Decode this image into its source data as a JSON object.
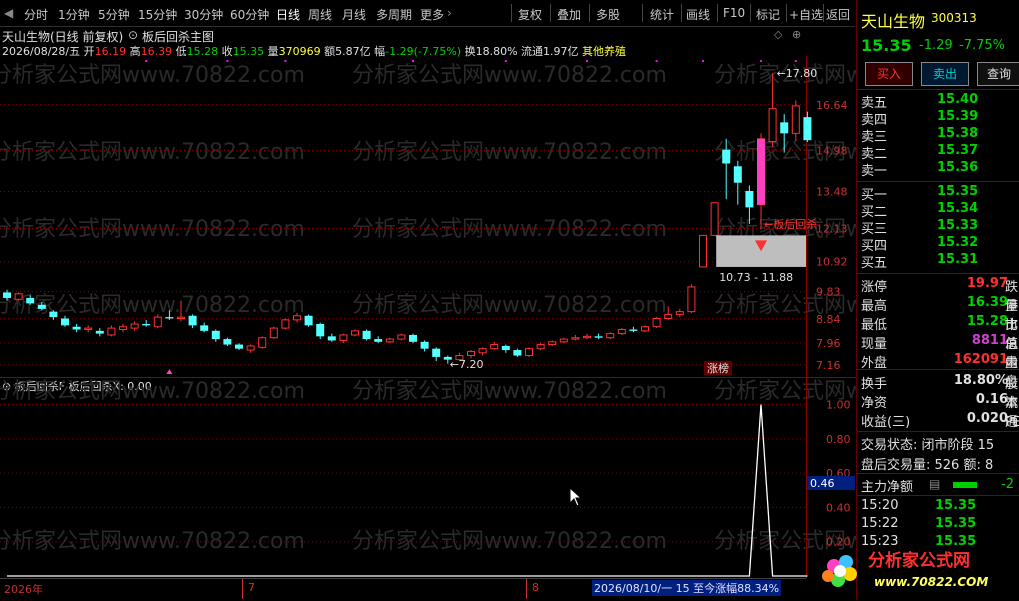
{
  "toolbar": {
    "items": [
      "分时",
      "1分钟",
      "5分钟",
      "15分钟",
      "30分钟",
      "60分钟",
      "日线",
      "周线",
      "月线",
      "多周期",
      "更多"
    ],
    "right_items": [
      "复权",
      "叠加",
      "多股",
      "统计",
      "画线",
      "F10",
      "标记",
      "+自选",
      "返回"
    ]
  },
  "header": {
    "title": "天山生物(日线 前复权)",
    "formula": "板后回杀主图",
    "date": "2026/08/28/五",
    "open_label": "开",
    "open": "16.19",
    "high_label": "高",
    "high": "16.39",
    "low_label": "低",
    "low": "15.28",
    "close_label": "收",
    "close": "15.35",
    "vol_label": "量",
    "vol": "370969",
    "amount_label": "额",
    "amount": "5.87亿",
    "change_label": "幅",
    "change": "-1.29(-7.75%)",
    "turnover_label": "换",
    "turnover": "18.80%",
    "float_label": "流通",
    "float": "1.97亿",
    "industry": "其他养殖"
  },
  "main_axis": [
    "16.64",
    "14.98",
    "13.48",
    "12.13",
    "10.92",
    "9.83",
    "8.84",
    "7.96",
    "7.16"
  ],
  "annotations": {
    "high_mark": "17.80",
    "low_mark": "7.20",
    "range_box": "10.73 - 11.88",
    "signal_text": "板后回杀",
    "zhangbang": "涨榜"
  },
  "indicator": {
    "title": "板后回杀F",
    "value_text": "板后回杀X: 0.00",
    "axis": [
      "1.00",
      "0.80",
      "0.60",
      "0.40",
      "0.20"
    ],
    "cursor_value": "0.46"
  },
  "bottom": {
    "year": "2026年",
    "month7": "7",
    "month8": "8",
    "range_text": "2026/08/10/一 15 至今涨幅88.34%"
  },
  "watermark": "分析家公式网www.70822.com",
  "panel": {
    "name": "天山生物",
    "code": "300313",
    "price": "15.35",
    "change": "-1.29",
    "change_pct": "-7.75%",
    "buy_btn": "买入",
    "sell_btn": "卖出",
    "query_btn": "查询",
    "asks": [
      {
        "label": "卖五",
        "price": "15.40"
      },
      {
        "label": "卖四",
        "price": "15.39"
      },
      {
        "label": "卖三",
        "price": "15.38"
      },
      {
        "label": "卖二",
        "price": "15.37"
      },
      {
        "label": "卖一",
        "price": "15.36"
      }
    ],
    "bids": [
      {
        "label": "买一",
        "price": "15.35"
      },
      {
        "label": "买二",
        "price": "15.34"
      },
      {
        "label": "买三",
        "price": "15.33"
      },
      {
        "label": "买四",
        "price": "15.32"
      },
      {
        "label": "买五",
        "price": "15.31"
      }
    ],
    "stats": [
      {
        "label": "涨停",
        "value": "19.97",
        "cut": "跌停",
        "color": "#ff3030"
      },
      {
        "label": "最高",
        "value": "16.39",
        "cut": "量比",
        "color": "#00d000"
      },
      {
        "label": "最低",
        "value": "15.28",
        "cut": "市值",
        "color": "#00d000"
      },
      {
        "label": "现量",
        "value": "8811",
        "cut": "总量",
        "color": "#d040d0"
      },
      {
        "label": "外盘",
        "value": "162091",
        "cut": "内盘",
        "color": "#ff3030"
      }
    ],
    "stats2": [
      {
        "label": "换手",
        "value": "18.80%",
        "cut": "股本",
        "color": "#e0e0e0"
      },
      {
        "label": "净资",
        "value": "0.16",
        "cut": "流通",
        "color": "#e0e0e0"
      },
      {
        "label": "收益(三)",
        "value": "0.020",
        "cut": "PE(动",
        "color": "#e0e0e0"
      }
    ],
    "trade_state": "交易状态: 闭市阶段 15",
    "after_vol": "盘后交易量: 526  额: 8",
    "main_net_label": "主力净额",
    "main_net_value": "-2",
    "ticks": [
      {
        "time": "15:20",
        "price": "15.35"
      },
      {
        "time": "15:22",
        "price": "15.35"
      },
      {
        "time": "15:23",
        "price": "15.35"
      }
    ]
  },
  "logo": {
    "cn": "分析家公式网",
    "url": "www.70822.COM"
  },
  "colors": {
    "up": "#ff3030",
    "down": "#54ffff",
    "green": "#00d000",
    "grid": "#8b0000",
    "magenta": "#ff00ff"
  },
  "chart_data": {
    "type": "candlestick",
    "candles": [
      {
        "o": 9.8,
        "c": 9.6,
        "h": 9.9,
        "l": 9.5
      },
      {
        "o": 9.55,
        "c": 9.75,
        "h": 9.8,
        "l": 9.5
      },
      {
        "o": 9.6,
        "c": 9.4,
        "h": 9.7,
        "l": 9.35
      },
      {
        "o": 9.35,
        "c": 9.2,
        "h": 9.45,
        "l": 9.15
      },
      {
        "o": 9.1,
        "c": 8.9,
        "h": 9.15,
        "l": 8.8
      },
      {
        "o": 8.85,
        "c": 8.6,
        "h": 8.95,
        "l": 8.55
      },
      {
        "o": 8.55,
        "c": 8.45,
        "h": 8.65,
        "l": 8.35
      },
      {
        "o": 8.45,
        "c": 8.5,
        "h": 8.6,
        "l": 8.35
      },
      {
        "o": 8.4,
        "c": 8.3,
        "h": 8.5,
        "l": 8.2
      },
      {
        "o": 8.25,
        "c": 8.5,
        "h": 8.6,
        "l": 8.2
      },
      {
        "o": 8.45,
        "c": 8.55,
        "h": 8.65,
        "l": 8.35
      },
      {
        "o": 8.5,
        "c": 8.65,
        "h": 8.75,
        "l": 8.4
      },
      {
        "o": 8.65,
        "c": 8.6,
        "h": 8.8,
        "l": 8.55
      },
      {
        "o": 8.55,
        "c": 8.9,
        "h": 9.0,
        "l": 8.5
      },
      {
        "o": 8.9,
        "c": 8.85,
        "h": 9.15,
        "l": 8.8
      },
      {
        "o": 8.85,
        "c": 8.9,
        "h": 9.5,
        "l": 8.75
      },
      {
        "o": 8.95,
        "c": 8.6,
        "h": 9.0,
        "l": 8.5
      },
      {
        "o": 8.6,
        "c": 8.4,
        "h": 8.7,
        "l": 8.35
      },
      {
        "o": 8.4,
        "c": 8.1,
        "h": 8.45,
        "l": 8.0
      },
      {
        "o": 8.1,
        "c": 7.9,
        "h": 8.15,
        "l": 7.85
      },
      {
        "o": 7.9,
        "c": 7.75,
        "h": 7.95,
        "l": 7.7
      },
      {
        "o": 7.7,
        "c": 7.85,
        "h": 7.9,
        "l": 7.6
      },
      {
        "o": 7.8,
        "c": 8.15,
        "h": 8.2,
        "l": 7.75
      },
      {
        "o": 8.15,
        "c": 8.5,
        "h": 8.55,
        "l": 8.1
      },
      {
        "o": 8.5,
        "c": 8.8,
        "h": 8.85,
        "l": 8.45
      },
      {
        "o": 8.8,
        "c": 8.95,
        "h": 9.05,
        "l": 8.7
      },
      {
        "o": 8.95,
        "c": 8.6,
        "h": 9.0,
        "l": 8.55
      },
      {
        "o": 8.65,
        "c": 8.2,
        "h": 8.7,
        "l": 8.1
      },
      {
        "o": 8.2,
        "c": 8.05,
        "h": 8.3,
        "l": 8.0
      },
      {
        "o": 8.05,
        "c": 8.25,
        "h": 8.3,
        "l": 7.95
      },
      {
        "o": 8.25,
        "c": 8.4,
        "h": 8.45,
        "l": 8.2
      },
      {
        "o": 8.4,
        "c": 8.1,
        "h": 8.45,
        "l": 8.05
      },
      {
        "o": 8.1,
        "c": 8.0,
        "h": 8.2,
        "l": 7.95
      },
      {
        "o": 8.0,
        "c": 8.1,
        "h": 8.15,
        "l": 7.95
      },
      {
        "o": 8.1,
        "c": 8.25,
        "h": 8.3,
        "l": 8.05
      },
      {
        "o": 8.25,
        "c": 8.0,
        "h": 8.3,
        "l": 7.95
      },
      {
        "o": 8.0,
        "c": 7.75,
        "h": 8.05,
        "l": 7.65
      },
      {
        "o": 7.75,
        "c": 7.45,
        "h": 7.8,
        "l": 7.3
      },
      {
        "o": 7.45,
        "c": 7.35,
        "h": 7.5,
        "l": 7.2
      },
      {
        "o": 7.35,
        "c": 7.5,
        "h": 7.6,
        "l": 7.3
      },
      {
        "o": 7.5,
        "c": 7.65,
        "h": 7.7,
        "l": 7.4
      },
      {
        "o": 7.6,
        "c": 7.75,
        "h": 7.8,
        "l": 7.5
      },
      {
        "o": 7.75,
        "c": 7.9,
        "h": 8.0,
        "l": 7.7
      },
      {
        "o": 7.85,
        "c": 7.7,
        "h": 7.9,
        "l": 7.6
      },
      {
        "o": 7.7,
        "c": 7.5,
        "h": 7.75,
        "l": 7.45
      },
      {
        "o": 7.5,
        "c": 7.75,
        "h": 7.8,
        "l": 7.45
      },
      {
        "o": 7.75,
        "c": 7.9,
        "h": 7.95,
        "l": 7.7
      },
      {
        "o": 7.9,
        "c": 8.0,
        "h": 8.05,
        "l": 7.85
      },
      {
        "o": 8.0,
        "c": 8.1,
        "h": 8.15,
        "l": 7.95
      },
      {
        "o": 8.1,
        "c": 8.15,
        "h": 8.25,
        "l": 8.05
      },
      {
        "o": 8.15,
        "c": 8.2,
        "h": 8.3,
        "l": 8.1
      },
      {
        "o": 8.2,
        "c": 8.15,
        "h": 8.3,
        "l": 8.1
      },
      {
        "o": 8.15,
        "c": 8.3,
        "h": 8.35,
        "l": 8.1
      },
      {
        "o": 8.3,
        "c": 8.45,
        "h": 8.5,
        "l": 8.25
      },
      {
        "o": 8.45,
        "c": 8.4,
        "h": 8.55,
        "l": 8.35
      },
      {
        "o": 8.4,
        "c": 8.55,
        "h": 8.6,
        "l": 8.35
      },
      {
        "o": 8.55,
        "c": 8.85,
        "h": 8.9,
        "l": 8.5
      },
      {
        "o": 8.85,
        "c": 9.0,
        "h": 9.3,
        "l": 8.8
      },
      {
        "o": 9.0,
        "c": 9.1,
        "h": 9.2,
        "l": 8.9
      },
      {
        "o": 9.1,
        "c": 10.0,
        "h": 10.1,
        "l": 9.05
      },
      {
        "o": 10.73,
        "c": 11.88,
        "h": 11.88,
        "l": 10.73
      },
      {
        "o": 11.88,
        "c": 13.07,
        "h": 13.07,
        "l": 11.88
      },
      {
        "o": 15.0,
        "c": 14.5,
        "h": 15.4,
        "l": 13.2
      },
      {
        "o": 14.4,
        "c": 13.8,
        "h": 14.6,
        "l": 13.0
      },
      {
        "o": 13.5,
        "c": 12.9,
        "h": 13.7,
        "l": 12.3
      },
      {
        "o": 13.0,
        "c": 15.4,
        "h": 15.6,
        "l": 12.1
      },
      {
        "o": 15.3,
        "c": 16.5,
        "h": 17.8,
        "l": 15.1
      },
      {
        "o": 16.0,
        "c": 15.6,
        "h": 16.3,
        "l": 14.9
      },
      {
        "o": 15.6,
        "c": 16.6,
        "h": 16.8,
        "l": 15.3
      },
      {
        "o": 16.19,
        "c": 15.35,
        "h": 16.39,
        "l": 15.28
      }
    ],
    "ylim": [
      6.9,
      18.2
    ],
    "indicator_values": [
      0,
      0,
      0,
      0,
      0,
      0,
      0,
      0,
      0,
      0,
      0,
      0,
      0,
      0,
      0,
      0,
      0,
      0,
      0,
      0,
      0,
      0,
      0,
      0,
      0,
      0,
      0,
      0,
      0,
      0,
      0,
      0,
      0,
      0,
      0,
      0,
      0,
      0,
      0,
      0,
      0,
      0,
      0,
      0,
      0,
      0,
      0,
      0,
      0,
      0,
      0,
      0,
      0,
      0,
      0,
      0,
      0,
      0,
      0,
      0,
      0,
      0,
      0,
      0,
      0,
      1,
      0,
      0,
      0,
      0
    ],
    "indicator_ylim": [
      0,
      1.05
    ]
  }
}
